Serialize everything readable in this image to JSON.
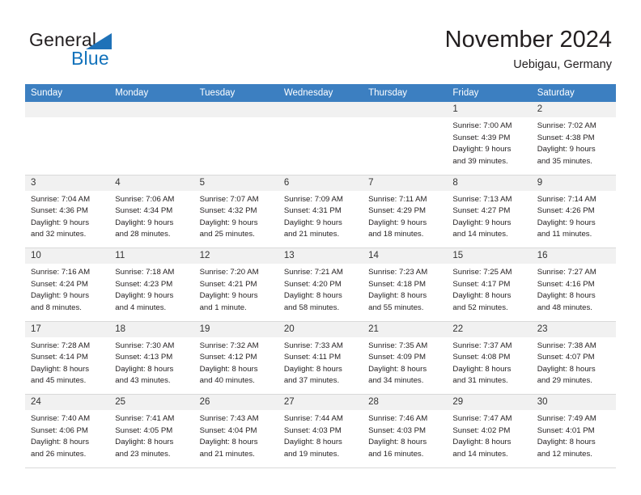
{
  "brand": {
    "word1": "General",
    "word2": "Blue",
    "triangle_color": "#1f72b8",
    "blue_color": "#1272bb"
  },
  "header": {
    "title": "November 2024",
    "subtitle": "Uebigau, Germany"
  },
  "theme": {
    "header_row_bg": "#3c7fc1",
    "daynum_bg": "#f1f1f1",
    "row_border": "#d9d9d9",
    "text": "#231f20"
  },
  "weekdays": [
    "Sunday",
    "Monday",
    "Tuesday",
    "Wednesday",
    "Thursday",
    "Friday",
    "Saturday"
  ],
  "weeks": [
    [
      {
        "day": "",
        "lines": []
      },
      {
        "day": "",
        "lines": []
      },
      {
        "day": "",
        "lines": []
      },
      {
        "day": "",
        "lines": []
      },
      {
        "day": "",
        "lines": []
      },
      {
        "day": "1",
        "lines": [
          "Sunrise: 7:00 AM",
          "Sunset: 4:39 PM",
          "Daylight: 9 hours",
          "and 39 minutes."
        ]
      },
      {
        "day": "2",
        "lines": [
          "Sunrise: 7:02 AM",
          "Sunset: 4:38 PM",
          "Daylight: 9 hours",
          "and 35 minutes."
        ]
      }
    ],
    [
      {
        "day": "3",
        "lines": [
          "Sunrise: 7:04 AM",
          "Sunset: 4:36 PM",
          "Daylight: 9 hours",
          "and 32 minutes."
        ]
      },
      {
        "day": "4",
        "lines": [
          "Sunrise: 7:06 AM",
          "Sunset: 4:34 PM",
          "Daylight: 9 hours",
          "and 28 minutes."
        ]
      },
      {
        "day": "5",
        "lines": [
          "Sunrise: 7:07 AM",
          "Sunset: 4:32 PM",
          "Daylight: 9 hours",
          "and 25 minutes."
        ]
      },
      {
        "day": "6",
        "lines": [
          "Sunrise: 7:09 AM",
          "Sunset: 4:31 PM",
          "Daylight: 9 hours",
          "and 21 minutes."
        ]
      },
      {
        "day": "7",
        "lines": [
          "Sunrise: 7:11 AM",
          "Sunset: 4:29 PM",
          "Daylight: 9 hours",
          "and 18 minutes."
        ]
      },
      {
        "day": "8",
        "lines": [
          "Sunrise: 7:13 AM",
          "Sunset: 4:27 PM",
          "Daylight: 9 hours",
          "and 14 minutes."
        ]
      },
      {
        "day": "9",
        "lines": [
          "Sunrise: 7:14 AM",
          "Sunset: 4:26 PM",
          "Daylight: 9 hours",
          "and 11 minutes."
        ]
      }
    ],
    [
      {
        "day": "10",
        "lines": [
          "Sunrise: 7:16 AM",
          "Sunset: 4:24 PM",
          "Daylight: 9 hours",
          "and 8 minutes."
        ]
      },
      {
        "day": "11",
        "lines": [
          "Sunrise: 7:18 AM",
          "Sunset: 4:23 PM",
          "Daylight: 9 hours",
          "and 4 minutes."
        ]
      },
      {
        "day": "12",
        "lines": [
          "Sunrise: 7:20 AM",
          "Sunset: 4:21 PM",
          "Daylight: 9 hours",
          "and 1 minute."
        ]
      },
      {
        "day": "13",
        "lines": [
          "Sunrise: 7:21 AM",
          "Sunset: 4:20 PM",
          "Daylight: 8 hours",
          "and 58 minutes."
        ]
      },
      {
        "day": "14",
        "lines": [
          "Sunrise: 7:23 AM",
          "Sunset: 4:18 PM",
          "Daylight: 8 hours",
          "and 55 minutes."
        ]
      },
      {
        "day": "15",
        "lines": [
          "Sunrise: 7:25 AM",
          "Sunset: 4:17 PM",
          "Daylight: 8 hours",
          "and 52 minutes."
        ]
      },
      {
        "day": "16",
        "lines": [
          "Sunrise: 7:27 AM",
          "Sunset: 4:16 PM",
          "Daylight: 8 hours",
          "and 48 minutes."
        ]
      }
    ],
    [
      {
        "day": "17",
        "lines": [
          "Sunrise: 7:28 AM",
          "Sunset: 4:14 PM",
          "Daylight: 8 hours",
          "and 45 minutes."
        ]
      },
      {
        "day": "18",
        "lines": [
          "Sunrise: 7:30 AM",
          "Sunset: 4:13 PM",
          "Daylight: 8 hours",
          "and 43 minutes."
        ]
      },
      {
        "day": "19",
        "lines": [
          "Sunrise: 7:32 AM",
          "Sunset: 4:12 PM",
          "Daylight: 8 hours",
          "and 40 minutes."
        ]
      },
      {
        "day": "20",
        "lines": [
          "Sunrise: 7:33 AM",
          "Sunset: 4:11 PM",
          "Daylight: 8 hours",
          "and 37 minutes."
        ]
      },
      {
        "day": "21",
        "lines": [
          "Sunrise: 7:35 AM",
          "Sunset: 4:09 PM",
          "Daylight: 8 hours",
          "and 34 minutes."
        ]
      },
      {
        "day": "22",
        "lines": [
          "Sunrise: 7:37 AM",
          "Sunset: 4:08 PM",
          "Daylight: 8 hours",
          "and 31 minutes."
        ]
      },
      {
        "day": "23",
        "lines": [
          "Sunrise: 7:38 AM",
          "Sunset: 4:07 PM",
          "Daylight: 8 hours",
          "and 29 minutes."
        ]
      }
    ],
    [
      {
        "day": "24",
        "lines": [
          "Sunrise: 7:40 AM",
          "Sunset: 4:06 PM",
          "Daylight: 8 hours",
          "and 26 minutes."
        ]
      },
      {
        "day": "25",
        "lines": [
          "Sunrise: 7:41 AM",
          "Sunset: 4:05 PM",
          "Daylight: 8 hours",
          "and 23 minutes."
        ]
      },
      {
        "day": "26",
        "lines": [
          "Sunrise: 7:43 AM",
          "Sunset: 4:04 PM",
          "Daylight: 8 hours",
          "and 21 minutes."
        ]
      },
      {
        "day": "27",
        "lines": [
          "Sunrise: 7:44 AM",
          "Sunset: 4:03 PM",
          "Daylight: 8 hours",
          "and 19 minutes."
        ]
      },
      {
        "day": "28",
        "lines": [
          "Sunrise: 7:46 AM",
          "Sunset: 4:03 PM",
          "Daylight: 8 hours",
          "and 16 minutes."
        ]
      },
      {
        "day": "29",
        "lines": [
          "Sunrise: 7:47 AM",
          "Sunset: 4:02 PM",
          "Daylight: 8 hours",
          "and 14 minutes."
        ]
      },
      {
        "day": "30",
        "lines": [
          "Sunrise: 7:49 AM",
          "Sunset: 4:01 PM",
          "Daylight: 8 hours",
          "and 12 minutes."
        ]
      }
    ]
  ]
}
